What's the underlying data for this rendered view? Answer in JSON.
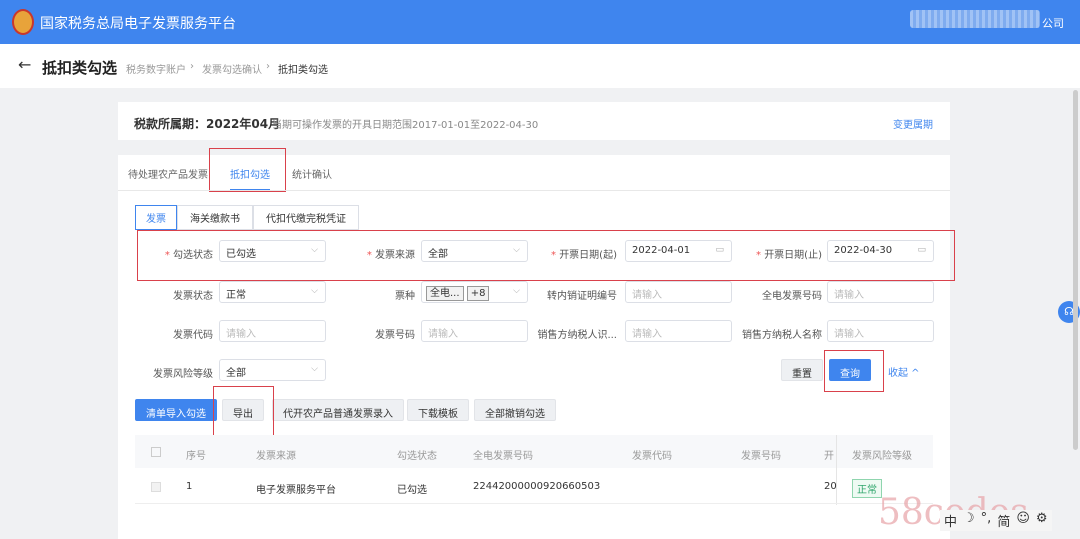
{
  "header": {
    "title": "国家税务总局电子发票服务平台",
    "user_suffix": "公司"
  },
  "page": {
    "title": "抵扣类勾选",
    "breadcrumb": [
      "税务数字账户",
      "发票勾选确认",
      "抵扣类勾选"
    ]
  },
  "period": {
    "label": "税款所属期：2022年04月",
    "note": "当期可操作发票的开具日期范围2017-01-01至2022-04-30",
    "change": "变更属期"
  },
  "tabs": [
    "待处理农产品发票",
    "抵扣勾选",
    "统计确认"
  ],
  "subtabs": [
    "发票",
    "海关缴款书",
    "代扣代缴完税凭证"
  ],
  "filters": {
    "check_status": {
      "label": "勾选状态",
      "value": "已勾选"
    },
    "source": {
      "label": "发票来源",
      "value": "全部"
    },
    "date_from": {
      "label": "开票日期(起)",
      "value": "2022-04-01"
    },
    "date_to": {
      "label": "开票日期(止)",
      "value": "2022-04-30"
    },
    "inv_status": {
      "label": "发票状态",
      "value": "正常"
    },
    "type": {
      "label": "票种",
      "tag": "全电...",
      "more": "+8"
    },
    "transfer_no": {
      "label": "转内销证明编号",
      "placeholder": "请输入"
    },
    "full_no": {
      "label": "全电发票号码",
      "placeholder": "请输入"
    },
    "code": {
      "label": "发票代码",
      "placeholder": "请输入"
    },
    "number": {
      "label": "发票号码",
      "placeholder": "请输入"
    },
    "seller_id": {
      "label": "销售方纳税人识...",
      "placeholder": "请输入"
    },
    "seller_name": {
      "label": "销售方纳税人名称",
      "placeholder": "请输入"
    },
    "risk": {
      "label": "发票风险等级",
      "value": "全部"
    },
    "reset": "重置",
    "query": "查询",
    "collapse": "收起"
  },
  "actions": [
    "清单导入勾选",
    "导出",
    "代开农产品普通发票录入",
    "下载模板",
    "全部撤销勾选"
  ],
  "table": {
    "columns": [
      "序号",
      "发票来源",
      "勾选状态",
      "全电发票号码",
      "发票代码",
      "发票号码",
      "开",
      "发票风险等级"
    ],
    "rows": [
      {
        "no": "1",
        "source": "电子发票服务平台",
        "status": "已勾选",
        "full_no": "22442000000920660503",
        "date": "20",
        "risk": "正常"
      }
    ]
  },
  "watermark": "58codes",
  "ime": [
    "中",
    "☽",
    "°,",
    "简",
    "☺",
    "⚙"
  ]
}
